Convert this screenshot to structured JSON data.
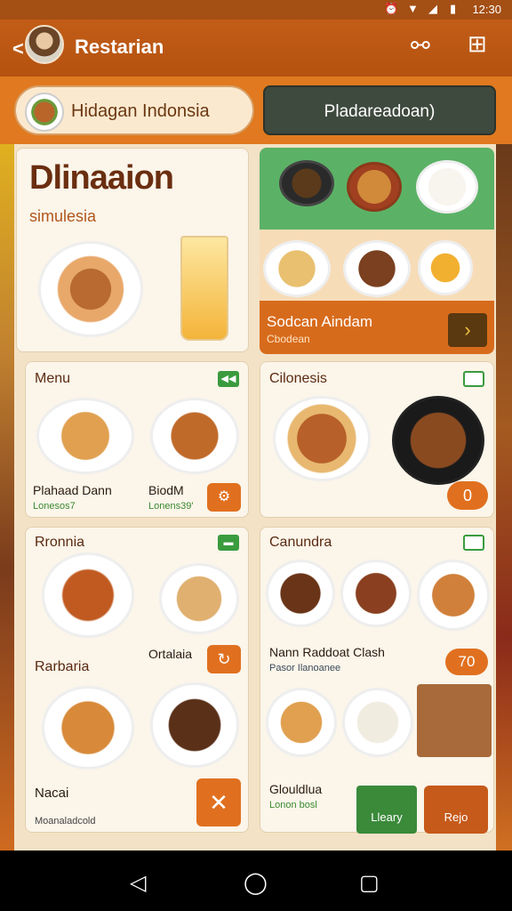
{
  "status": {
    "time": "12:30"
  },
  "appbar": {
    "title": "Restarian"
  },
  "search": {
    "pill_text": "Hidagan Indonsia",
    "action_label": "Pladareadoan)"
  },
  "hero": {
    "title": "Dlinaaion",
    "subtitle": "simulesia"
  },
  "promo": {
    "title": "Sodcan Aindam",
    "subtitle": "Cbodean"
  },
  "sections": {
    "menu": {
      "title": "Menu",
      "item1_name": "Plahaad Dann",
      "item1_price": "Lonesos7",
      "item2_name": "BiodM",
      "item2_price": "Lonens39'"
    },
    "cuisine": {
      "title": "Cilonesis",
      "count": "0"
    },
    "ronnia": {
      "title": "Rronnia",
      "label_right": "Ortalaia",
      "subtitle2": "Rarbaria",
      "bottom_label": "Nacai",
      "bottom_sub": "Moanaladcold"
    },
    "canundra": {
      "title": "Canundra",
      "item_name": "Nann Raddoat Clash",
      "item_sub": "Pasor Ilanoanee",
      "badge": "70",
      "bottom_name": "Glouldlua",
      "bottom_price": "Lonon bosl",
      "btn1": "Lleary",
      "btn2": "Rejo"
    }
  },
  "colors": {
    "accent": "#e0701f",
    "brand": "#b4520f",
    "green": "#3a9b3e"
  }
}
